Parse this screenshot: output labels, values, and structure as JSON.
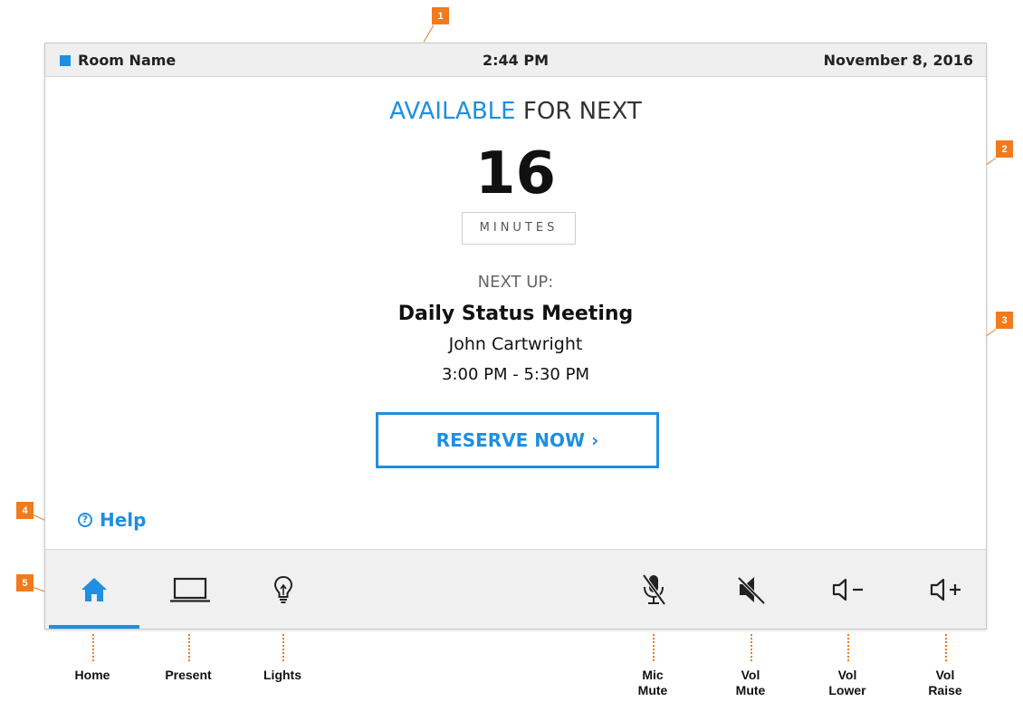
{
  "status_bar": {
    "room_name": "Room Name",
    "time": "2:44 PM",
    "date": "November 8, 2016"
  },
  "availability": {
    "available_word": "AVAILABLE",
    "for_next": " FOR NEXT",
    "minutes_value": "16",
    "minutes_unit": "MINUTES"
  },
  "next_up": {
    "label": "NEXT UP:",
    "title": "Daily Status Meeting",
    "organizer": "John Cartwright",
    "time_range": "3:00 PM - 5:30 PM"
  },
  "reserve_button": {
    "label": "RESERVE NOW ›"
  },
  "help": {
    "icon_glyph": "?",
    "label": "Help"
  },
  "toolbar": {
    "active": "home",
    "labels": {
      "home": "Home",
      "present": "Present",
      "lights": "Lights",
      "mic_mute": "Mic\nMute",
      "vol_mute": "Vol\nMute",
      "vol_lower": "Vol\nLower",
      "vol_raise": "Vol\nRaise"
    }
  },
  "callouts": [
    "1",
    "2",
    "3",
    "4",
    "5"
  ],
  "colors": {
    "accent": "#1e8fe1",
    "callout": "#f07b1c",
    "toolbar_bg": "#f0f0f0"
  }
}
